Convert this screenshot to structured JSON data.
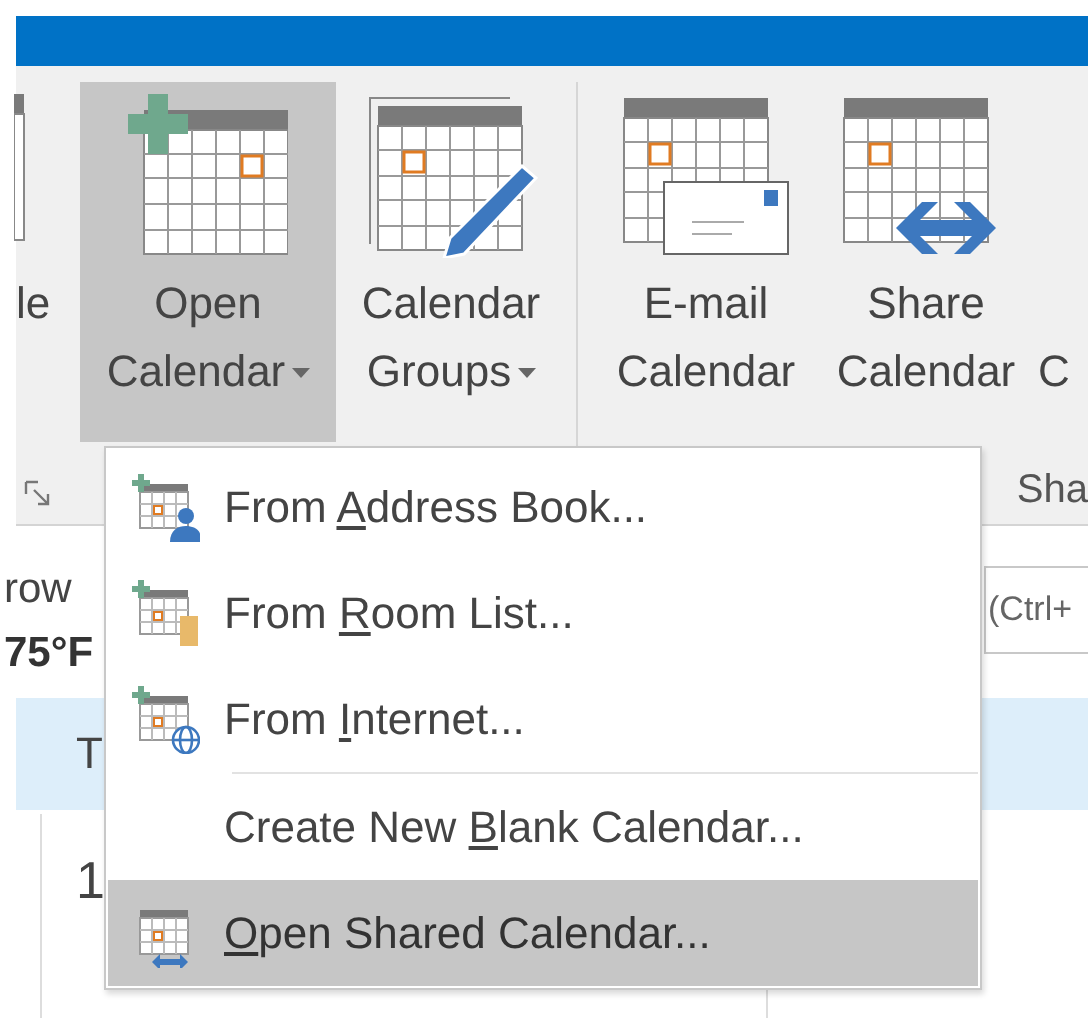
{
  "ribbon": {
    "buttons": [
      {
        "kind": "partial",
        "line1": "le",
        "selected": false,
        "dropdown": false
      },
      {
        "kind": "open",
        "line1": "Open",
        "line2": "Calendar",
        "selected": true,
        "dropdown": true
      },
      {
        "kind": "groups",
        "line1": "Calendar",
        "line2": "Groups",
        "selected": false,
        "dropdown": true
      },
      {
        "kind": "email",
        "line1": "E-mail",
        "line2": "Calendar",
        "selected": false,
        "dropdown": false
      },
      {
        "kind": "share",
        "line1": "Share",
        "line2": "Calendar",
        "selected": false,
        "dropdown": false
      },
      {
        "kind": "cut",
        "line2": "C",
        "selected": false,
        "dropdown": false
      }
    ],
    "group_label": "Sha"
  },
  "background": {
    "line_1": "row",
    "line_2": "75°F",
    "row_text": "T",
    "row_text_2": "1",
    "search_hint": "(Ctrl+"
  },
  "menu": {
    "items": [
      {
        "kind": "address",
        "before": "From ",
        "key": "A",
        "after": "ddress Book...",
        "selected": false
      },
      {
        "kind": "room",
        "before": "From ",
        "key": "R",
        "after": "oom List...",
        "selected": false
      },
      {
        "kind": "internet",
        "before": "From ",
        "key": "I",
        "after": "nternet...",
        "selected": false
      },
      {
        "kind": "plain",
        "before": "Create New ",
        "key": "B",
        "after": "lank Calendar...",
        "selected": false
      },
      {
        "kind": "shared",
        "key": "O",
        "after": "pen Shared Calendar...",
        "selected": true
      }
    ]
  }
}
